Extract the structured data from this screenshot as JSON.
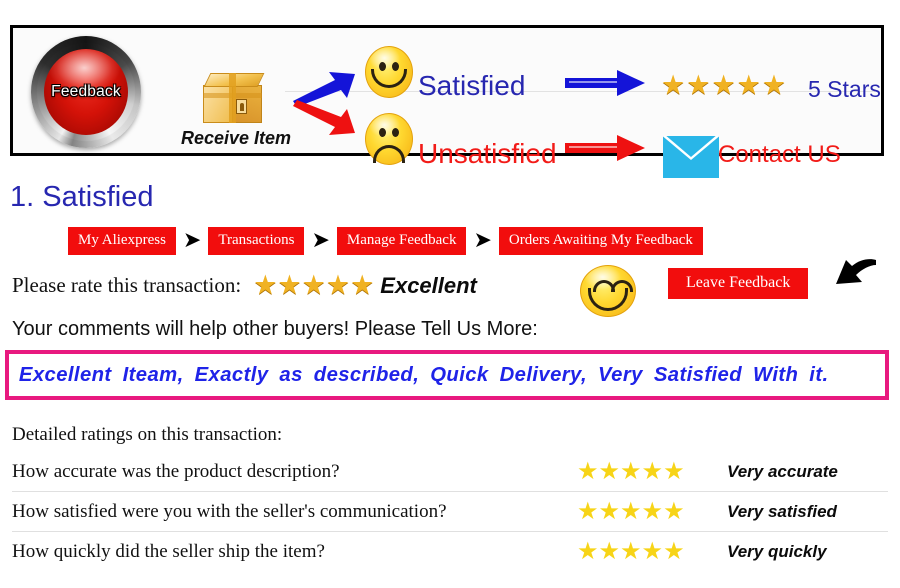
{
  "banner": {
    "feedback_button_label": "Feedback",
    "receive_item_label": "Receive Item",
    "satisfied_label": "Satisfied",
    "unsatisfied_label": "Unsatisfied",
    "five_stars_label": "5 Stars",
    "contact_us_label": "Contact US",
    "star_glyph": "★",
    "star_count": 5,
    "colors": {
      "satisfied_blue": "#2727b0",
      "unsatisfied_red": "#f21b18",
      "gold_star": "#f0b223",
      "envelope_cyan": "#29b6e8",
      "button_red": "#d41208"
    }
  },
  "section": {
    "title": "1. Satisfied"
  },
  "breadcrumb": {
    "separator": "➤",
    "items": [
      {
        "label": "My Aliexpress"
      },
      {
        "label": "Transactions"
      },
      {
        "label": "Manage Feedback"
      },
      {
        "label": "Orders Awaiting My Feedback"
      }
    ],
    "background": "#f20d0d"
  },
  "rate": {
    "question": "Please rate this transaction:",
    "star_glyph": "★",
    "star_count": 5,
    "rating_word": "Excellent",
    "leave_feedback_label": "Leave Feedback"
  },
  "comments": {
    "prompt": "Your comments will help other buyers! Please Tell Us More:",
    "text": "Excellent Iteam, Exactly as described, Quick Delivery, Very Satisfied With it.",
    "border_color": "#e8197f",
    "text_color": "#1f23e8"
  },
  "detailed_ratings": {
    "title": "Detailed ratings on this transaction:",
    "star_glyph": "★",
    "rows": [
      {
        "question": "How accurate was the product description?",
        "stars": 5,
        "answer": "Very accurate"
      },
      {
        "question": "How satisfied were you with the seller's communication?",
        "stars": 5,
        "answer": "Very satisfied"
      },
      {
        "question": "How quickly did the seller ship the item?",
        "stars": 5,
        "answer": "Very quickly"
      }
    ]
  }
}
